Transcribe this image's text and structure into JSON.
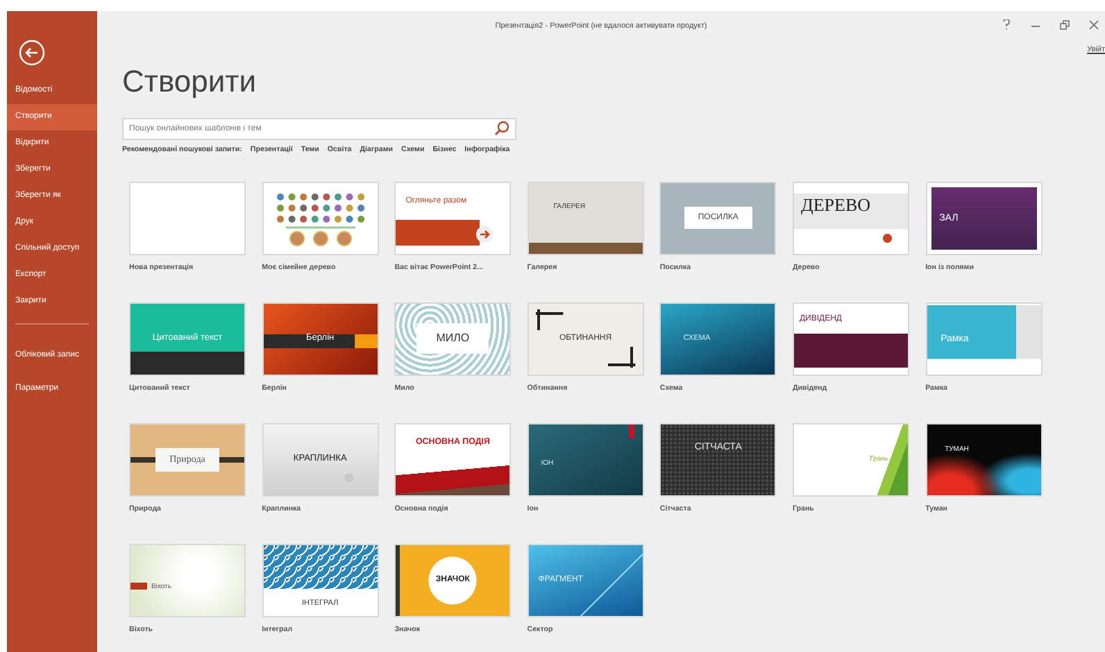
{
  "window": {
    "title": "Презентація2 - PowerPoint (не вдалося активувати продукт)",
    "sign_in": "Увійт"
  },
  "sidebar": {
    "items": [
      {
        "label": "Відомості",
        "selected": false
      },
      {
        "label": "Створити",
        "selected": true
      },
      {
        "label": "Відкрити",
        "selected": false
      },
      {
        "label": "Зберегти",
        "selected": false
      },
      {
        "label": "Зберегти як",
        "selected": false
      },
      {
        "label": "Друк",
        "selected": false
      },
      {
        "label": "Спільний доступ",
        "selected": false
      },
      {
        "label": "Експорт",
        "selected": false
      },
      {
        "label": "Закрити",
        "selected": false
      }
    ],
    "bottom_items": [
      {
        "label": "Обліковий запис",
        "selected": false
      },
      {
        "label": "Параметри",
        "selected": false
      }
    ]
  },
  "heading": "Створити",
  "search": {
    "placeholder": "Пошук онлайнових шаблонів і тем"
  },
  "suggested": {
    "label": "Рекомендовані пошукові запити:",
    "links": [
      "Презентації",
      "Теми",
      "Освіта",
      "Діаграми",
      "Схеми",
      "Бізнес",
      "Інфографіка"
    ]
  },
  "templates": [
    {
      "name": "Нова презентація",
      "kind": "blank"
    },
    {
      "name": "Моє сімейне дерево",
      "kind": "tree"
    },
    {
      "name": "Вас вітає PowerPoint 2...",
      "kind": "tour",
      "preview": "Огляньте разом"
    },
    {
      "name": "Галерея",
      "kind": "gallery",
      "preview": "ГАЛЕРЕЯ"
    },
    {
      "name": "Посилка",
      "kind": "parcel",
      "preview": "ПОСИЛКА"
    },
    {
      "name": "Дерево",
      "kind": "wood",
      "preview": "ДЕРЕВО"
    },
    {
      "name": "Іон із полями",
      "kind": "ionboard",
      "preview": "ЗАЛ"
    },
    {
      "name": "Цитований текст",
      "kind": "quote",
      "preview": "Цитований текст"
    },
    {
      "name": "Берлін",
      "kind": "berlin",
      "preview": "Берлін"
    },
    {
      "name": "Мило",
      "kind": "savon",
      "preview": "МИЛО"
    },
    {
      "name": "Обтинання",
      "kind": "crop",
      "preview": "ОБТИНАННЯ"
    },
    {
      "name": "Схема",
      "kind": "circuit",
      "preview": "СХЕМА"
    },
    {
      "name": "Дивіденд",
      "kind": "dividend",
      "preview": "ДИВІДЕНД"
    },
    {
      "name": "Рамка",
      "kind": "frame",
      "preview": "Рамка"
    },
    {
      "name": "Природа",
      "kind": "organic",
      "preview": "Природа"
    },
    {
      "name": "Краплинка",
      "kind": "droplet",
      "preview": "КРАПЛИНКА"
    },
    {
      "name": "Основна подія",
      "kind": "mainevent",
      "preview": "ОСНОВНА ПОДІЯ"
    },
    {
      "name": "Іон",
      "kind": "ion",
      "preview": "ІОН"
    },
    {
      "name": "Сітчаста",
      "kind": "mesh",
      "preview": "СІТЧАСТА"
    },
    {
      "name": "Грань",
      "kind": "facet",
      "preview": "Грань"
    },
    {
      "name": "Туман",
      "kind": "vapor",
      "preview": "ТУМАН"
    },
    {
      "name": "Віхоть",
      "kind": "wisp",
      "preview": "Віхоть"
    },
    {
      "name": "Інтеграл",
      "kind": "integral",
      "preview": "ІНТЕГРАЛ"
    },
    {
      "name": "Значок",
      "kind": "badge",
      "preview": "ЗНАЧОК"
    },
    {
      "name": "Сектор",
      "kind": "slice",
      "preview": "ФРАГМЕНТ"
    }
  ]
}
